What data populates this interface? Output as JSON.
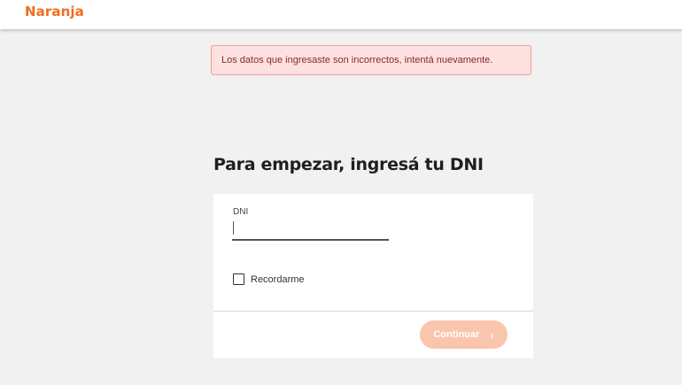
{
  "header": {
    "brand": "Naranja"
  },
  "alert": {
    "message": "Los datos que ingresaste son incorrectos, intentá nuevamente."
  },
  "form": {
    "title": "Para empezar, ingresá tu DNI",
    "dni_label": "DNI",
    "dni_value": "",
    "remember_label": "Recordarme",
    "remember_checked": false,
    "continue_label": "Continuar",
    "continue_icon": "chevron-right-icon"
  },
  "colors": {
    "brand": "#f26b1d",
    "alert_background": "#fce1e0",
    "alert_border": "#ee9e9a",
    "button_disabled": "#f9c5ad",
    "page_background": "#f1f1f1"
  }
}
